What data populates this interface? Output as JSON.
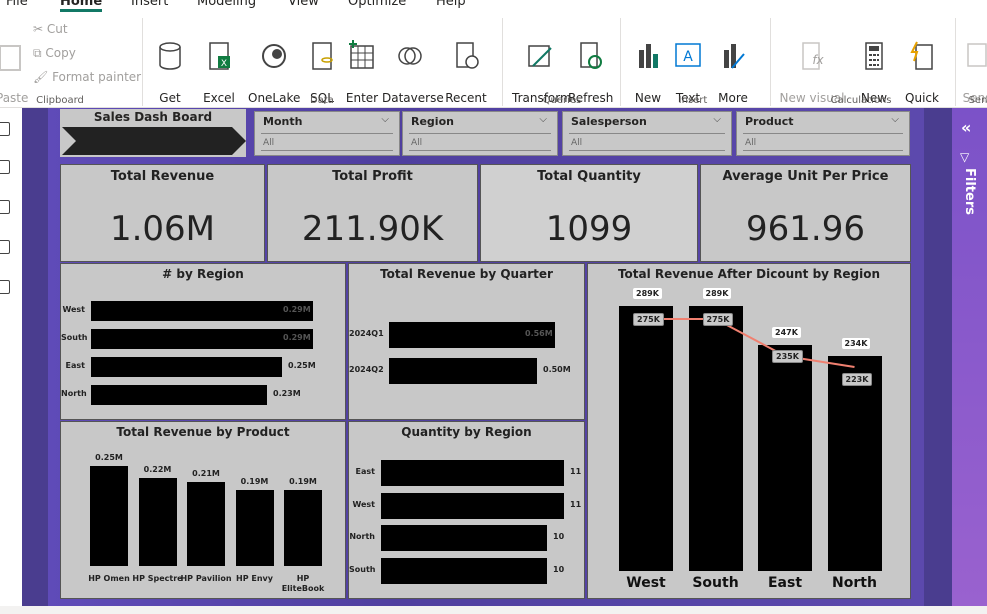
{
  "ribbon": {
    "tabs": [
      "File",
      "Home",
      "Insert",
      "Modeling",
      "View",
      "Optimize",
      "Help"
    ],
    "clipboard": {
      "paste": "Paste",
      "cut": "Cut",
      "copy": "Copy",
      "format_painter": "Format painter",
      "group": "Clipboard"
    },
    "data": {
      "get_data": "Get\ndata ⌄",
      "excel": "Excel\nworkbook",
      "onelake": "OneLake\ncatalog ⌄",
      "sql": "SQL\nServer",
      "enter": "Enter\ndata",
      "dataverse": "Dataverse",
      "recent": "Recent\nsources ⌄",
      "group": "Data"
    },
    "queries": {
      "transform": "Transform\ndata ⌄",
      "refresh": "Refresh",
      "group": "Queries"
    },
    "insert": {
      "new_visual": "New\nvisual",
      "text_box": "Text\nbox",
      "more": "More\nvisuals ⌄",
      "group": "Insert"
    },
    "calculations": {
      "new_calc": "New visual\ncalculation ⌄",
      "new_measure": "New\nmeasure",
      "quick": "Quick\nmeasure",
      "group": "Calculations"
    },
    "sensitivity": {
      "label": "Sens",
      "group": "Sen"
    }
  },
  "filters_pane": {
    "label": "Filters"
  },
  "report": {
    "header": "Sales Dash Board",
    "slicers": [
      {
        "label": "Month",
        "value": "All"
      },
      {
        "label": "Region",
        "value": "All"
      },
      {
        "label": "Salesperson",
        "value": "All"
      },
      {
        "label": "Product",
        "value": "All"
      }
    ],
    "kpis": [
      {
        "title": "Total Revenue",
        "value": "1.06M"
      },
      {
        "title": "Total Profit",
        "value": "211.90K"
      },
      {
        "title": "Total Quantity",
        "value": "1099"
      },
      {
        "title": "Average Unit Per Price",
        "value": "961.96"
      }
    ],
    "colors": {
      "bar": "#000000",
      "card": "#c8c8c8",
      "canvas": "#4a3d8f",
      "line": "#f08070",
      "filters": "#8a58cc"
    }
  },
  "chart_data": [
    {
      "type": "bar",
      "title": "# by Region",
      "orientation": "horizontal",
      "categories": [
        "West",
        "South",
        "East",
        "North"
      ],
      "values": [
        0.29,
        0.29,
        0.25,
        0.23
      ],
      "labels": [
        "0.29M",
        "0.29M",
        "0.25M",
        "0.23M"
      ]
    },
    {
      "type": "bar",
      "title": "Total Revenue by Quarter",
      "orientation": "horizontal",
      "categories": [
        "2024Q1",
        "2024Q2"
      ],
      "values": [
        0.56,
        0.5
      ],
      "labels": [
        "0.56M",
        "0.50M"
      ]
    },
    {
      "type": "bar",
      "title": "Total Revenue by Product",
      "orientation": "vertical",
      "categories": [
        "HP Omen",
        "HP Spectre",
        "HP Pavilion",
        "HP Envy",
        "HP EliteBook"
      ],
      "values": [
        0.25,
        0.22,
        0.21,
        0.19,
        0.19
      ],
      "labels": [
        "0.25M",
        "0.22M",
        "0.21M",
        "0.19M",
        "0.19M"
      ]
    },
    {
      "type": "bar",
      "title": "Quantity by Region",
      "orientation": "horizontal",
      "categories": [
        "East",
        "West",
        "North",
        "South"
      ],
      "values": [
        11,
        11,
        10,
        10
      ],
      "labels": [
        "11",
        "11",
        "10",
        "10"
      ]
    },
    {
      "type": "bar",
      "title": "Total Revenue After Dicount by Region",
      "orientation": "vertical",
      "categories": [
        "West",
        "South",
        "East",
        "North"
      ],
      "series": [
        {
          "kind": "bar",
          "values": [
            289,
            289,
            247,
            234
          ],
          "labels": [
            "289K",
            "289K",
            "247K",
            "234K"
          ]
        },
        {
          "kind": "line",
          "values": [
            275,
            275,
            235,
            223
          ],
          "labels": [
            "275K",
            "275K",
            "235K",
            "223K"
          ]
        }
      ]
    }
  ]
}
